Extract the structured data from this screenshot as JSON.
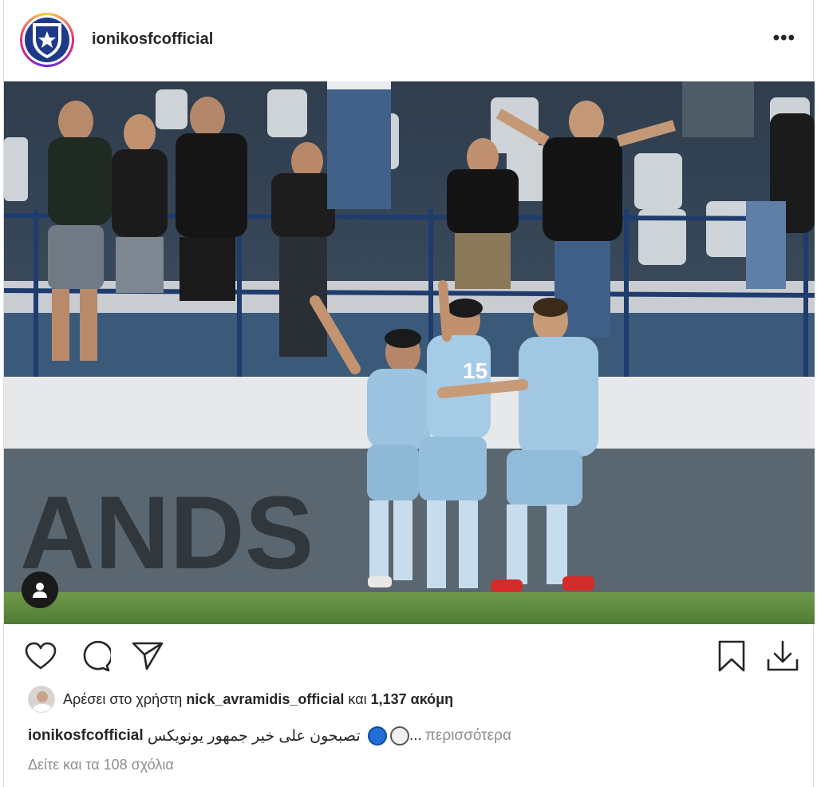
{
  "post": {
    "username": "ionikosfcofficial",
    "more_label": "•••"
  },
  "icons": {
    "like": "heart-icon",
    "comment": "comment-icon",
    "share": "send-icon",
    "save": "bookmark-icon",
    "download": "download-icon",
    "tag": "user-tag-icon"
  },
  "likes": {
    "prefix": "Αρέσει στο χρήστη ",
    "user": "nick_avramidis_official",
    "middle": " και ",
    "count": "1,137 ακόμη"
  },
  "caption": {
    "user": "ionikosfcofficial",
    "text": " تصبحون على خير جمهور يونويكس ",
    "ellipsis": "...",
    "more": "περισσότερα"
  },
  "comments": {
    "label": "Δείτε και τα 108 σχόλια"
  },
  "colors": {
    "accent_blue": "#1f6fd6",
    "text": "#262626",
    "muted": "#8e8e8e",
    "kit": "#9cc4e0"
  }
}
